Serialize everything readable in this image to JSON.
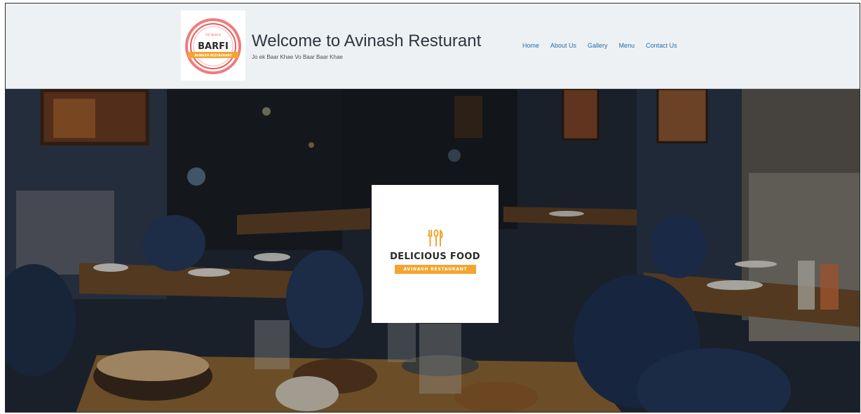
{
  "header": {
    "logo": {
      "top_text": "1st Special",
      "main_text": "BARFI",
      "ribbon_text": "AVINASH RESTAURANT",
      "colors": {
        "ring": "#ee5b5b",
        "ribbon": "#f2a531"
      }
    },
    "title": "Welcome to Avinash Resturant",
    "tagline": "Jo ek Baar Khae Vo Baar Baar Khae"
  },
  "nav": {
    "items": [
      "Home",
      "About Us",
      "Gallery",
      "Menu",
      "Contact Us"
    ]
  },
  "hero": {
    "background": "restaurant-interior-photo",
    "card": {
      "icon": "utensils-icon",
      "title": "DELICIOUS FOOD",
      "ribbon": "AVINASH RESTAURANT",
      "accent": "#f2a531"
    }
  },
  "colors": {
    "header_bg": "#eef1f3",
    "nav_link": "#1f6fb0",
    "title": "#2e3440"
  }
}
